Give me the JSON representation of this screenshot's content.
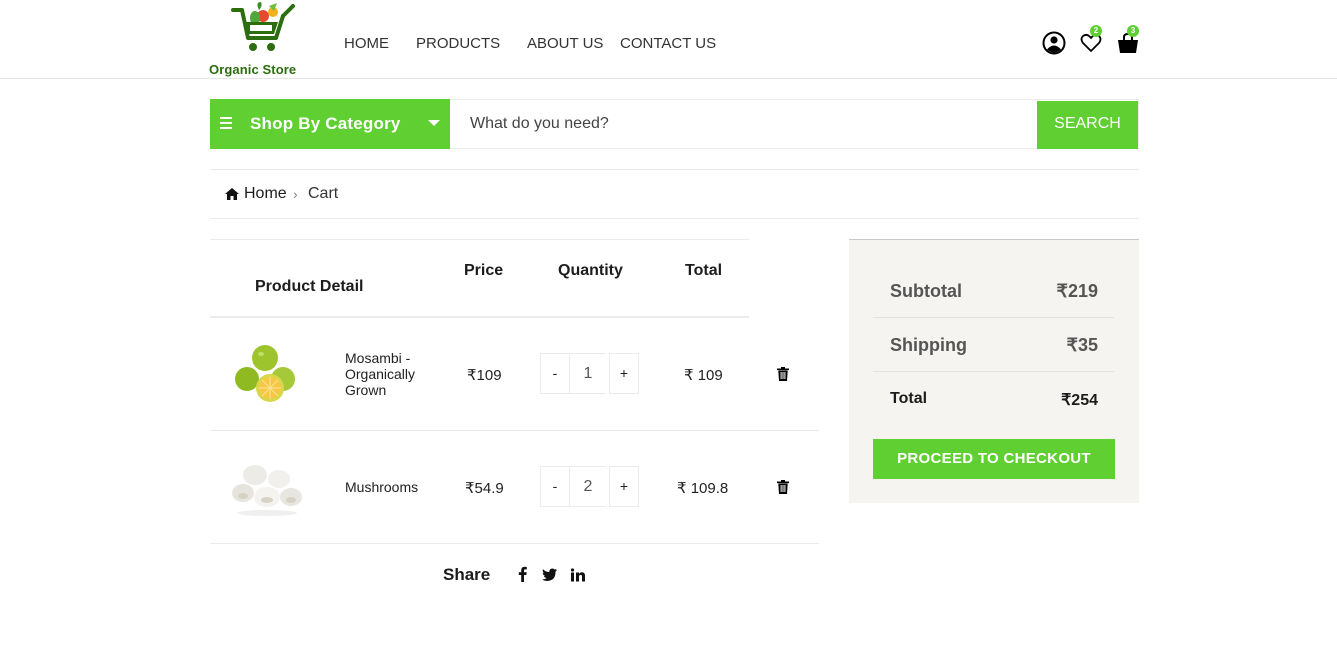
{
  "brand": {
    "name": "Organic Store",
    "accent": "#5fcf32",
    "logo_text_color": "#2c6d0f"
  },
  "nav": {
    "items": [
      "HOME",
      "PRODUCTS",
      "ABOUT US",
      "CONTACT US"
    ]
  },
  "header_icons": {
    "account": "user-circle-icon",
    "wishlist": "heart-icon",
    "cart": "shopping-bag-icon",
    "wishlist_count": "2",
    "cart_count": "3"
  },
  "search": {
    "category_label": "Shop By Category",
    "placeholder": "What do you need?",
    "button_label": "SEARCH"
  },
  "breadcrumb": {
    "home": "Home",
    "current": "Cart"
  },
  "cart": {
    "columns": {
      "product": "Product Detail",
      "price": "Price",
      "quantity": "Quantity",
      "total": "Total"
    },
    "items": [
      {
        "name": "Mosambi - Organically Grown",
        "price": "₹109",
        "quantity": "1",
        "total": "₹ 109"
      },
      {
        "name": "Mushrooms",
        "price": "₹54.9",
        "quantity": "2",
        "total": "₹ 109.8"
      }
    ],
    "minus_label": "-",
    "plus_label": "+"
  },
  "share": {
    "label": "Share",
    "networks": [
      "facebook-icon",
      "twitter-icon",
      "linkedin-icon"
    ]
  },
  "summary": {
    "subtotal_label": "Subtotal",
    "subtotal_value": "₹219",
    "shipping_label": "Shipping",
    "shipping_value": "₹35",
    "total_label": "Total",
    "total_value": "₹254",
    "checkout_label": "PROCEED TO CHECKOUT"
  }
}
